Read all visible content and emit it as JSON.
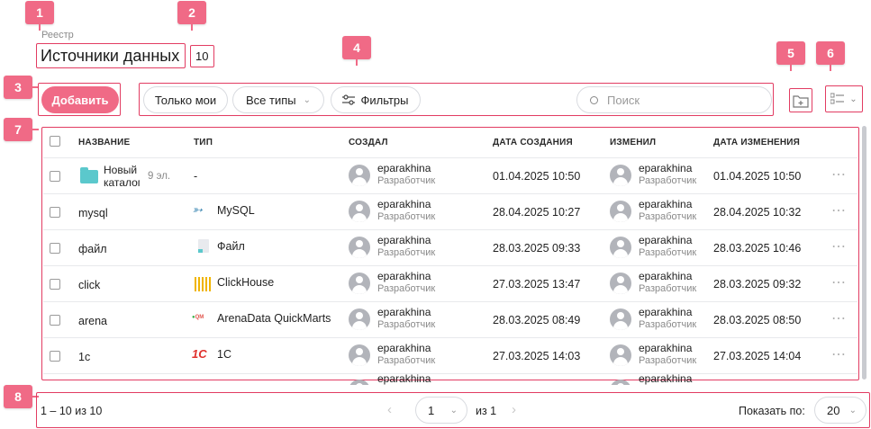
{
  "markers": [
    "1",
    "2",
    "3",
    "4",
    "5",
    "6",
    "7",
    "8"
  ],
  "header": {
    "breadcrumb": "Реестр",
    "title": "Источники данных",
    "count": "10"
  },
  "toolbar": {
    "add_label": "Добавить",
    "only_mine_label": "Только мои",
    "all_types_label": "Все типы",
    "filters_label": "Фильтры",
    "search_placeholder": "Поиск"
  },
  "columns": [
    "НАЗВАНИЕ",
    "ТИП",
    "СОЗДАЛ",
    "ДАТА СОЗДАНИЯ",
    "ИЗМЕНИЛ",
    "ДАТА ИЗМЕНЕНИЯ"
  ],
  "rows": [
    {
      "name": "Новый каталог",
      "name_line1": "Новый",
      "name_line2": "каталог",
      "items": "9 эл.",
      "icon": "folder-icon",
      "type": "-",
      "creator": "eparakhina",
      "creator_role": "Разработчик",
      "created": "01.04.2025 10:50",
      "modifier": "eparakhina",
      "modifier_role": "Разработчик",
      "modified": "01.04.2025 10:50"
    },
    {
      "name": "mysql",
      "type_icon": "mysql-icon",
      "type": "MySQL",
      "creator": "eparakhina",
      "creator_role": "Разработчик",
      "created": "28.04.2025 10:27",
      "modifier": "eparakhina",
      "modifier_role": "Разработчик",
      "modified": "28.04.2025 10:32"
    },
    {
      "name": "файл",
      "type_icon": "file-icon",
      "type": "Файл",
      "creator": "eparakhina",
      "creator_role": "Разработчик",
      "created": "28.03.2025 09:33",
      "modifier": "eparakhina",
      "modifier_role": "Разработчик",
      "modified": "28.03.2025 10:46"
    },
    {
      "name": "click",
      "type_icon": "clickhouse-icon",
      "type": "ClickHouse",
      "creator": "eparakhina",
      "creator_role": "Разработчик",
      "created": "27.03.2025 13:47",
      "modifier": "eparakhina",
      "modifier_role": "Разработчик",
      "modified": "28.03.2025 09:32"
    },
    {
      "name": "arena",
      "type_icon": "arenadata-icon",
      "type": "ArenaData QuickMarts",
      "type_icon_text": "QM",
      "creator": "eparakhina",
      "creator_role": "Разработчик",
      "created": "28.03.2025 08:49",
      "modifier": "eparakhina",
      "modifier_role": "Разработчик",
      "modified": "28.03.2025 08:50"
    },
    {
      "name": "1с",
      "type_icon": "1c-icon",
      "type": "1С",
      "type_icon_text": "1С",
      "creator": "eparakhina",
      "creator_role": "Разработчик",
      "created": "27.03.2025 14:03",
      "modifier": "eparakhina",
      "modifier_role": "Разработчик",
      "modified": "27.03.2025 14:04"
    },
    {
      "creator": "eparakhina",
      "modifier": "eparakhina"
    }
  ],
  "pagination": {
    "range_text": "1 – 10 из 10",
    "page": "1",
    "of_text": "из 1",
    "show_label": "Показать по:",
    "page_size": "20"
  },
  "colors": {
    "accent": "#f06a86",
    "marker_border": "#e23c62",
    "folder": "#5bc8cc",
    "clickhouse": "#f0b400"
  }
}
